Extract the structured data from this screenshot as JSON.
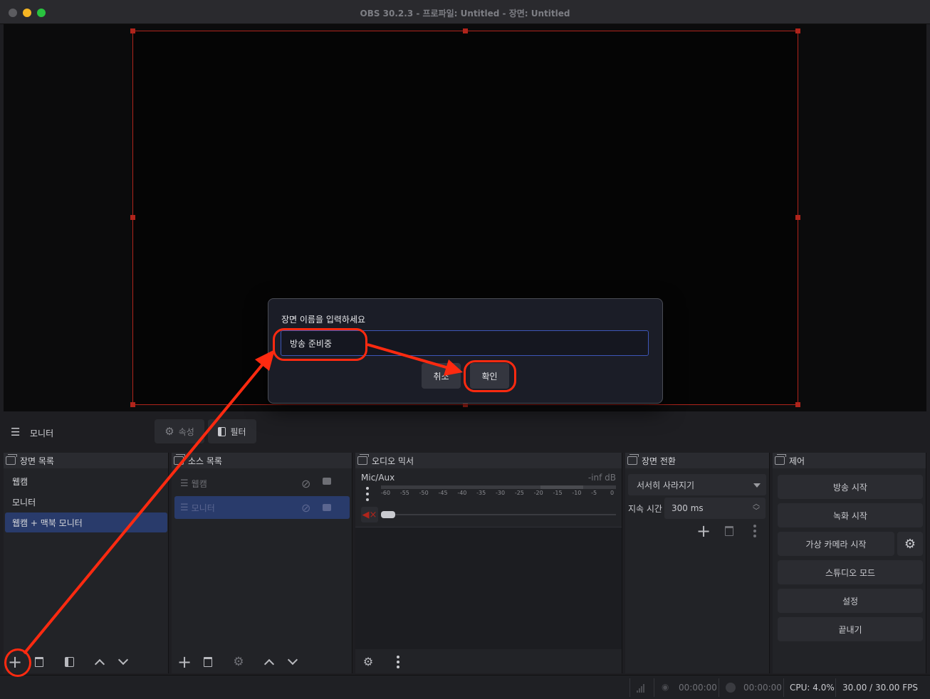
{
  "window": {
    "title": "OBS 30.2.3 - 프로파일: Untitled - 장면: Untitled"
  },
  "toolbar": {
    "current_source": "모니터",
    "properties_label": "속성",
    "filters_label": "필터"
  },
  "scenes": {
    "title": "장면 목록",
    "items": [
      {
        "label": "웹캠",
        "selected": false
      },
      {
        "label": "모니터",
        "selected": false
      },
      {
        "label": "웹캠 + 맥북 모니터",
        "selected": true
      }
    ]
  },
  "sources": {
    "title": "소스 목록",
    "items": [
      {
        "label": "웹캠",
        "selected": false
      },
      {
        "label": "모니터",
        "selected": true
      }
    ]
  },
  "audio": {
    "title": "오디오 믹서",
    "channel_name": "Mic/Aux",
    "level": "-inf dB",
    "ticks": [
      "-60",
      "-55",
      "-50",
      "-45",
      "-40",
      "-35",
      "-30",
      "-25",
      "-20",
      "-15",
      "-10",
      "-5",
      "0"
    ]
  },
  "transitions": {
    "title": "장면 전환",
    "selected": "서서히 사라지기",
    "duration_label": "지속 시간",
    "duration_value": "300 ms"
  },
  "controls": {
    "title": "제어",
    "start_streaming": "방송 시작",
    "start_recording": "녹화 시작",
    "start_virtual_camera": "가상 카메라 시작",
    "studio_mode": "스튜디오 모드",
    "settings": "설정",
    "exit": "끝내기"
  },
  "status": {
    "stream_time": "00:00:00",
    "record_time": "00:00:00",
    "cpu": "CPU: 4.0%",
    "fps": "30.00 / 30.00 FPS"
  },
  "dialog": {
    "prompt": "장면 이름을 입력하세요",
    "input_value": "방송 준비중",
    "cancel_label": "취소",
    "ok_label": "확인"
  },
  "colors": {
    "accent_selected": "#293b6b",
    "annotation": "#ff2a10",
    "canvas_border": "#b0241b"
  }
}
